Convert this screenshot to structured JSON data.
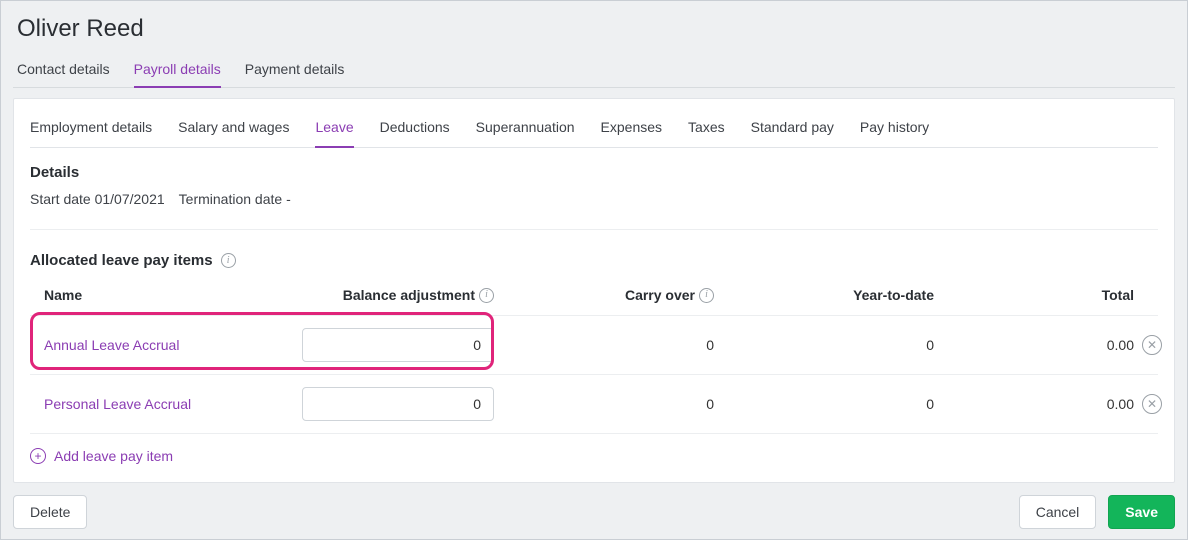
{
  "page": {
    "title": "Oliver Reed"
  },
  "topTabs": [
    {
      "label": "Contact details"
    },
    {
      "label": "Payroll details"
    },
    {
      "label": "Payment details"
    }
  ],
  "subTabs": [
    {
      "label": "Employment details"
    },
    {
      "label": "Salary and wages"
    },
    {
      "label": "Leave"
    },
    {
      "label": "Deductions"
    },
    {
      "label": "Superannuation"
    },
    {
      "label": "Expenses"
    },
    {
      "label": "Taxes"
    },
    {
      "label": "Standard pay"
    },
    {
      "label": "Pay history"
    }
  ],
  "details": {
    "heading": "Details",
    "startDateLabel": "Start date",
    "startDateValue": "01/07/2021",
    "terminationDateLabel": "Termination date",
    "terminationDateValue": "-"
  },
  "allocated": {
    "heading": "Allocated leave pay items",
    "columns": {
      "name": "Name",
      "balanceAdjustment": "Balance adjustment",
      "carryOver": "Carry over",
      "yearToDate": "Year-to-date",
      "total": "Total"
    },
    "rows": [
      {
        "name": "Annual Leave Accrual",
        "balance": "0",
        "carryOver": "0",
        "ytd": "0",
        "total": "0.00"
      },
      {
        "name": "Personal Leave Accrual",
        "balance": "0",
        "carryOver": "0",
        "ytd": "0",
        "total": "0.00"
      }
    ],
    "addLabel": "Add leave pay item"
  },
  "footer": {
    "delete": "Delete",
    "cancel": "Cancel",
    "save": "Save"
  }
}
